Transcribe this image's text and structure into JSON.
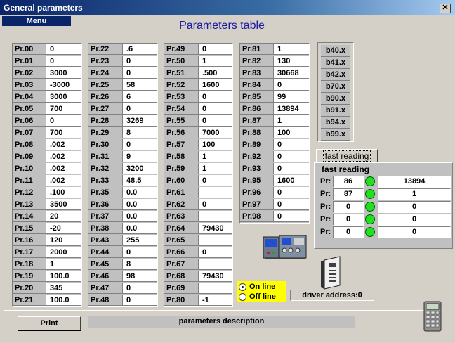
{
  "window": {
    "title": "General parameters",
    "close_glyph": "✕"
  },
  "menu": {
    "label": "Menu"
  },
  "header": {
    "title": "Parameters table"
  },
  "columns": [
    [
      [
        "Pr.00",
        "0"
      ],
      [
        "Pr.01",
        "0"
      ],
      [
        "Pr.02",
        "3000"
      ],
      [
        "Pr.03",
        "-3000"
      ],
      [
        "Pr.04",
        "3000"
      ],
      [
        "Pr.05",
        "700"
      ],
      [
        "Pr.06",
        "0"
      ],
      [
        "Pr.07",
        "700"
      ],
      [
        "Pr.08",
        ".002"
      ],
      [
        "Pr.09",
        ".002"
      ],
      [
        "Pr.10",
        ".002"
      ],
      [
        "Pr.11",
        ".002"
      ],
      [
        "Pr.12",
        ".100"
      ],
      [
        "Pr.13",
        "3500"
      ],
      [
        "Pr.14",
        "20"
      ],
      [
        "Pr.15",
        "-20"
      ],
      [
        "Pr.16",
        "120"
      ],
      [
        "Pr.17",
        "2000"
      ],
      [
        "Pr.18",
        "1"
      ],
      [
        "Pr.19",
        "100.0"
      ],
      [
        "Pr.20",
        "345"
      ],
      [
        "Pr.21",
        "100.0"
      ]
    ],
    [
      [
        "Pr.22",
        ".6"
      ],
      [
        "Pr.23",
        "0"
      ],
      [
        "Pr.24",
        "0"
      ],
      [
        "Pr.25",
        "58"
      ],
      [
        "Pr.26",
        "6"
      ],
      [
        "Pr.27",
        "0"
      ],
      [
        "Pr.28",
        "3269"
      ],
      [
        "Pr.29",
        "8"
      ],
      [
        "Pr.30",
        "0"
      ],
      [
        "Pr.31",
        "9"
      ],
      [
        "Pr.32",
        "3200"
      ],
      [
        "Pr.33",
        "48.5"
      ],
      [
        "Pr.35",
        "0.0"
      ],
      [
        "Pr.36",
        "0.0"
      ],
      [
        "Pr.37",
        "0.0"
      ],
      [
        "Pr.38",
        "0.0"
      ],
      [
        "Pr.43",
        "255"
      ],
      [
        "Pr.44",
        "0"
      ],
      [
        "Pr.45",
        "8"
      ],
      [
        "Pr.46",
        "98"
      ],
      [
        "Pr.47",
        "0"
      ],
      [
        "Pr.48",
        "0"
      ]
    ],
    [
      [
        "Pr.49",
        "0"
      ],
      [
        "Pr.50",
        "1"
      ],
      [
        "Pr.51",
        ".500"
      ],
      [
        "Pr.52",
        "1600"
      ],
      [
        "Pr.53",
        "0"
      ],
      [
        "Pr.54",
        "0"
      ],
      [
        "Pr.55",
        "0"
      ],
      [
        "Pr.56",
        "7000"
      ],
      [
        "Pr.57",
        "100"
      ],
      [
        "Pr.58",
        "1"
      ],
      [
        "Pr.59",
        "1"
      ],
      [
        "Pr.60",
        "0"
      ],
      [
        "Pr.61",
        ""
      ],
      [
        "Pr.62",
        "0"
      ],
      [
        "Pr.63",
        ""
      ],
      [
        "Pr.64",
        "79430"
      ],
      [
        "Pr.65",
        ""
      ],
      [
        "Pr.66",
        "0"
      ],
      [
        "Pr.67",
        ""
      ],
      [
        "Pr.68",
        "79430"
      ],
      [
        "Pr.69",
        ""
      ],
      [
        "Pr.80",
        "-1"
      ]
    ],
    [
      [
        "Pr.81",
        "1"
      ],
      [
        "Pr.82",
        "130"
      ],
      [
        "Pr.83",
        "30668"
      ],
      [
        "Pr.84",
        "0"
      ],
      [
        "Pr.85",
        "99"
      ],
      [
        "Pr.86",
        "13894"
      ],
      [
        "Pr.87",
        "1"
      ],
      [
        "Pr.88",
        "100"
      ],
      [
        "Pr.89",
        "0"
      ],
      [
        "Pr.92",
        "0"
      ],
      [
        "Pr.93",
        "0"
      ],
      [
        "Pr.95",
        "1600"
      ],
      [
        "Pr.96",
        "0"
      ],
      [
        "Pr.97",
        "0"
      ],
      [
        "Pr.98",
        "0"
      ]
    ]
  ],
  "bit_params": [
    "b40.x",
    "b41.x",
    "b42.x",
    "b70.x",
    "b90.x",
    "b91.x",
    "b94.x",
    "b99.x"
  ],
  "fast_reading": {
    "button_label": "fast reading",
    "panel_title": "fast reading",
    "row_label": "Pr:",
    "led_color": "#20e020",
    "rows": [
      {
        "param": "86",
        "value": "13894"
      },
      {
        "param": "87",
        "value": "1"
      },
      {
        "param": "0",
        "value": "0"
      },
      {
        "param": "0",
        "value": "0"
      },
      {
        "param": "0",
        "value": "0"
      }
    ]
  },
  "connection": {
    "options": [
      "On line",
      "Off line"
    ],
    "selected": "On line",
    "highlight_color": "#ffff00"
  },
  "driver": {
    "address_label": "driver address:0"
  },
  "footer": {
    "print_label": "Print",
    "description_label": "parameters description"
  },
  "icons": [
    "instruments-icon",
    "drive-unit-icon",
    "calculator-icon"
  ]
}
